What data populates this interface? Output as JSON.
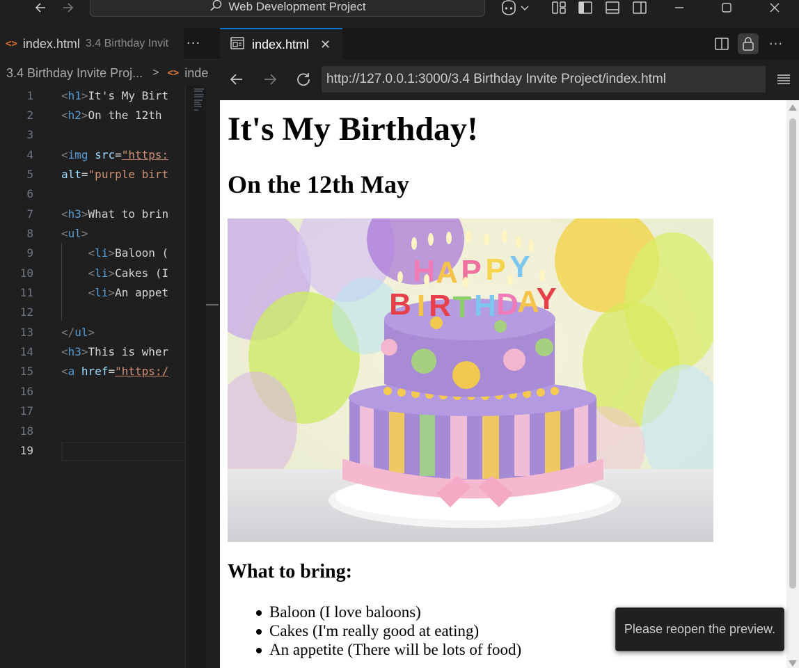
{
  "titlebar": {
    "search_text": "Web Development Project",
    "icons": [
      "arrow-left-icon",
      "arrow-right-icon",
      "search-icon",
      "copilot-icon",
      "chevron-down-icon",
      "layout-icon",
      "toggle-primary-sidebar-icon",
      "toggle-panel-icon",
      "toggle-secondary-sidebar-icon",
      "minimize-icon",
      "maximize-icon",
      "close-icon"
    ]
  },
  "left_editor": {
    "tab_name": "index.html",
    "tab_description": "3.4 Birthday Invit",
    "breadcrumb_folder": "3.4 Birthday Invite Proj...",
    "breadcrumb_file": "inde",
    "line_numbers": [
      "1",
      "2",
      "3",
      "4",
      "5",
      "6",
      "7",
      "8",
      "9",
      "10",
      "11",
      "12",
      "13",
      "14",
      "15",
      "16",
      "17",
      "18",
      "19"
    ],
    "active_line": "19",
    "code": {
      "l1_text": "It's My Birt",
      "l2_text": "On the 12th",
      "l4_attr": "src",
      "l4_value": "\"https:",
      "l5_attr": "alt",
      "l5_value": "\"purple birt",
      "l7_text": "What to brin",
      "l9_text": "Baloon (",
      "l10_text": "Cakes (I",
      "l11_text": "An appet",
      "l14_text": "This is wher",
      "l15_attr": "href",
      "l15_value": "\"https:/"
    }
  },
  "preview": {
    "tab_name": "index.html",
    "url": "http://127.0.0.1:3000/3.4 Birthday Invite Project/index.html",
    "page": {
      "h1": "It's My Birthday!",
      "h2": "On the 12th May",
      "image_alt": "purple birthday cake",
      "h3": "What to bring:",
      "list": [
        "Baloon (I love baloons)",
        "Cakes (I'm really good at eating)",
        "An appetite (There will be lots of food)"
      ]
    }
  },
  "toast": {
    "message": "Please reopen the preview."
  },
  "colors": {
    "editor_bg": "#1f1f1f",
    "tab_accent": "#0078d4",
    "tag_blue": "#569cd6",
    "attr_lightblue": "#9cdcfe",
    "string_orange": "#ce9178",
    "file_icon_orange": "#e37933"
  }
}
